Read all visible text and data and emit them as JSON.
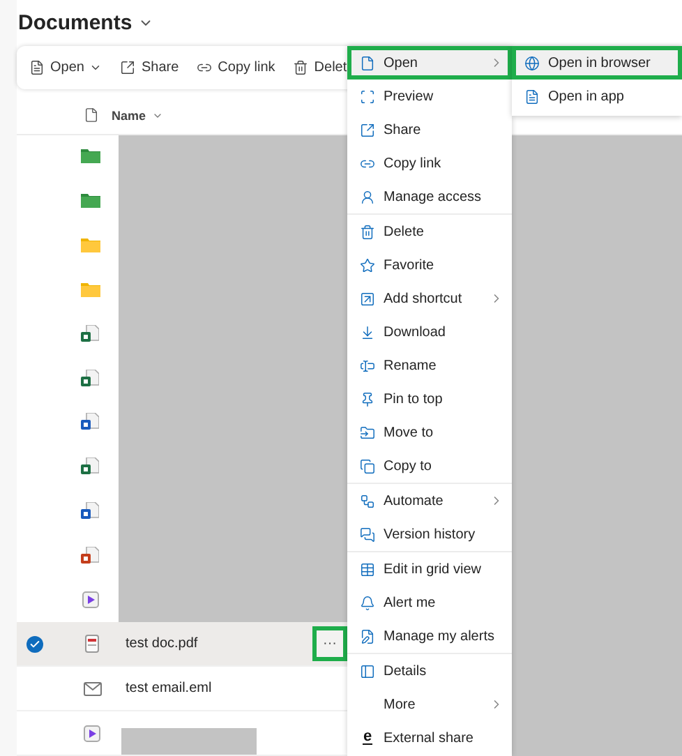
{
  "title": "Documents",
  "toolbar": [
    {
      "label": "Open",
      "dropdown": true
    },
    {
      "label": "Share",
      "dropdown": false
    },
    {
      "label": "Copy link",
      "dropdown": false
    },
    {
      "label": "Delet",
      "dropdown": false
    }
  ],
  "columns": [
    {
      "label": "Name"
    }
  ],
  "rows": [
    {
      "kind": "channel",
      "redacted": true,
      "selected": false
    },
    {
      "kind": "channel",
      "redacted": true,
      "selected": false
    },
    {
      "kind": "folder",
      "redacted": true,
      "selected": false
    },
    {
      "kind": "folder",
      "redacted": true,
      "selected": false
    },
    {
      "kind": "excel",
      "redacted": true,
      "selected": false
    },
    {
      "kind": "excel",
      "redacted": true,
      "selected": false
    },
    {
      "kind": "word",
      "redacted": true,
      "selected": false
    },
    {
      "kind": "excel",
      "redacted": true,
      "selected": false
    },
    {
      "kind": "word",
      "redacted": true,
      "selected": false
    },
    {
      "kind": "powerpoint",
      "redacted": true,
      "selected": false
    },
    {
      "kind": "video",
      "redacted": true,
      "selected": false
    },
    {
      "kind": "pdf",
      "name": "test doc.pdf",
      "redacted": false,
      "selected": true,
      "more": "···"
    },
    {
      "kind": "email",
      "name": "test email.eml",
      "redacted": false,
      "selected": false
    },
    {
      "kind": "video",
      "redacted": true,
      "selected": false
    }
  ],
  "context_menu": [
    {
      "label": "Open",
      "submenu": true,
      "selected": true,
      "outlined": true
    },
    {
      "label": "Preview",
      "submenu": false,
      "selected": false,
      "outlined": false
    },
    {
      "label": "Share",
      "submenu": false,
      "selected": false,
      "outlined": false
    },
    {
      "label": "Copy link",
      "submenu": false,
      "selected": false,
      "outlined": false
    },
    {
      "label": "Manage access",
      "submenu": false,
      "selected": false,
      "outlined": false,
      "divider_after": true
    },
    {
      "label": "Delete",
      "submenu": false,
      "selected": false,
      "outlined": false
    },
    {
      "label": "Favorite",
      "submenu": false,
      "selected": false,
      "outlined": false
    },
    {
      "label": "Add shortcut",
      "submenu": true,
      "selected": false,
      "outlined": false
    },
    {
      "label": "Download",
      "submenu": false,
      "selected": false,
      "outlined": false
    },
    {
      "label": "Rename",
      "submenu": false,
      "selected": false,
      "outlined": false
    },
    {
      "label": "Pin to top",
      "submenu": false,
      "selected": false,
      "outlined": false
    },
    {
      "label": "Move to",
      "submenu": false,
      "selected": false,
      "outlined": false
    },
    {
      "label": "Copy to",
      "submenu": false,
      "selected": false,
      "outlined": false,
      "divider_after": true
    },
    {
      "label": "Automate",
      "submenu": true,
      "selected": false,
      "outlined": false
    },
    {
      "label": "Version history",
      "submenu": false,
      "selected": false,
      "outlined": false,
      "divider_after": true
    },
    {
      "label": "Edit in grid view",
      "submenu": false,
      "selected": false,
      "outlined": false
    },
    {
      "label": "Alert me",
      "submenu": false,
      "selected": false,
      "outlined": false
    },
    {
      "label": "Manage my alerts",
      "submenu": false,
      "selected": false,
      "outlined": false,
      "divider_after": true
    },
    {
      "label": "Details",
      "submenu": false,
      "selected": false,
      "outlined": false
    },
    {
      "label": "More",
      "submenu": true,
      "selected": false,
      "outlined": false
    },
    {
      "label": "External share",
      "submenu": false,
      "selected": false,
      "outlined": false,
      "glyph": "e"
    }
  ],
  "submenu": [
    {
      "label": "Open in browser",
      "selected": true,
      "outlined": true
    },
    {
      "label": "Open in app",
      "selected": false,
      "outlined": false
    }
  ]
}
